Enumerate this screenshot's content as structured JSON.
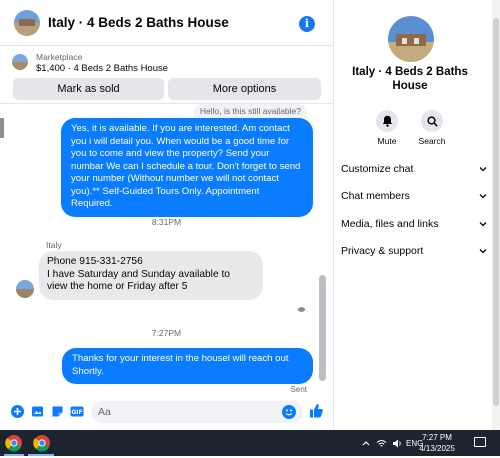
{
  "chat": {
    "title": "Italy · 4 Beds 2 Baths House",
    "marketplace_source": "Marketplace",
    "marketplace_listing": "$1,400 · 4 Beds 2 Baths House",
    "mark_sold_label": "Mark as sold",
    "more_options_label": "More options",
    "quoted_message": "Hello, is this still available?",
    "messages": [
      {
        "direction": "outgoing",
        "text": "Yes, it is available. If you are interested.  Am contact you i will detail you.  When would be a good time for you to come and view the property? Send your numbar We can I schedule a tour.  Don't forget to send your number (Without number we will not contact you).** Self-Guided Tours Only. Appointment Required."
      },
      {
        "timestamp": "8:31PM"
      },
      {
        "direction": "incoming",
        "sender": "Italy",
        "text": "Phone 915-331-2756\nI have Saturday and Sunday available to view the home or Friday after 5"
      },
      {
        "timestamp": "7:27PM"
      },
      {
        "direction": "outgoing",
        "text": "Thanks for your interest in the housel will reach out Shortly."
      }
    ],
    "sent_label": "Sent",
    "composer_placeholder": "Aa"
  },
  "panel": {
    "title": "Italy · 4 Beds 2 Baths House",
    "mute_label": "Mute",
    "search_label": "Search",
    "sections": [
      "Customize chat",
      "Chat members",
      "Media, files and links",
      "Privacy & support"
    ]
  },
  "taskbar": {
    "language": "ENG",
    "time": "7:27 PM",
    "date": "4/13/2025"
  },
  "colors": {
    "accent": "#0a7cff",
    "taskbar": "#1c2430"
  }
}
